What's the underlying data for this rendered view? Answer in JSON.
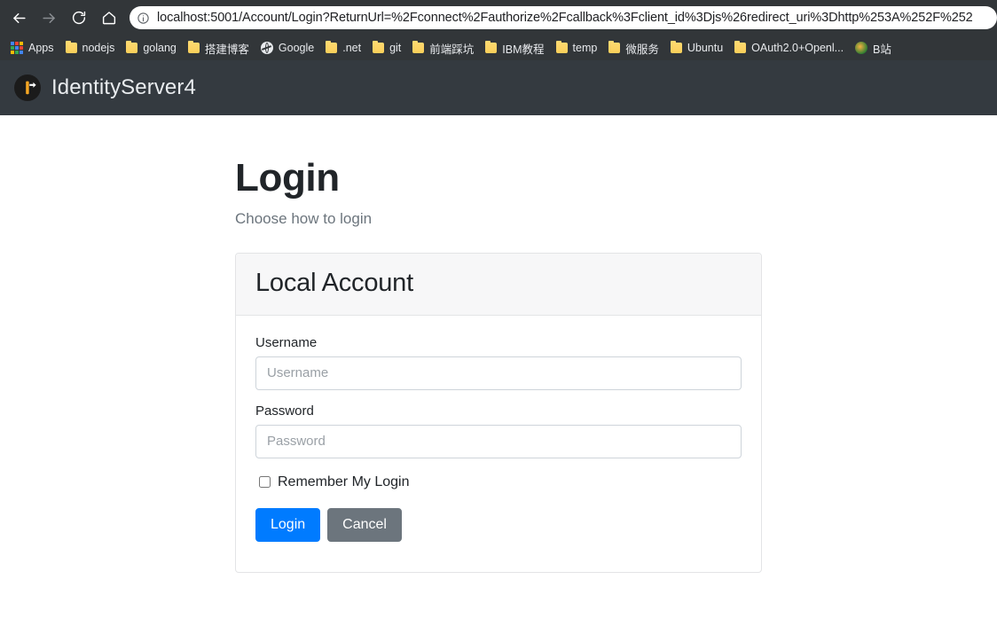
{
  "browser": {
    "nav": {
      "back": "back-arrow",
      "forward": "forward-arrow",
      "reload": "reload",
      "home": "home"
    },
    "omnibox": {
      "info_icon": "info-circle-icon",
      "url": "localhost:5001/Account/Login?ReturnUrl=%2Fconnect%2Fauthorize%2Fcallback%3Fclient_id%3Djs%26redirect_uri%3Dhttp%253A%252F%252"
    },
    "bookmarks": [
      {
        "label": "Apps",
        "icon": "apps-grid-icon"
      },
      {
        "label": "nodejs",
        "icon": "folder-icon"
      },
      {
        "label": "golang",
        "icon": "folder-icon"
      },
      {
        "label": "搭建博客",
        "icon": "folder-icon"
      },
      {
        "label": "Google",
        "icon": "globe-icon"
      },
      {
        "label": ".net",
        "icon": "folder-icon"
      },
      {
        "label": "git",
        "icon": "folder-icon"
      },
      {
        "label": "前端踩坑",
        "icon": "folder-icon"
      },
      {
        "label": "IBM教程",
        "icon": "folder-icon"
      },
      {
        "label": "temp",
        "icon": "folder-icon"
      },
      {
        "label": "微服务",
        "icon": "folder-icon"
      },
      {
        "label": "Ubuntu",
        "icon": "folder-icon"
      },
      {
        "label": "OAuth2.0+Openl...",
        "icon": "folder-icon"
      },
      {
        "label": "B站",
        "icon": "bilibili-icon"
      }
    ]
  },
  "site": {
    "brand": "IdentityServer4",
    "brand_logo": "identityserver-logo",
    "navbar_color": "#343a40"
  },
  "login": {
    "title": "Login",
    "subtitle": "Choose how to login",
    "panel_title": "Local Account",
    "username": {
      "label": "Username",
      "placeholder": "Username",
      "value": ""
    },
    "password": {
      "label": "Password",
      "placeholder": "Password",
      "value": ""
    },
    "remember": {
      "label": "Remember My Login",
      "checked": false
    },
    "buttons": {
      "login": "Login",
      "cancel": "Cancel"
    },
    "colors": {
      "primary": "#007bff",
      "secondary": "#6c757d"
    }
  }
}
